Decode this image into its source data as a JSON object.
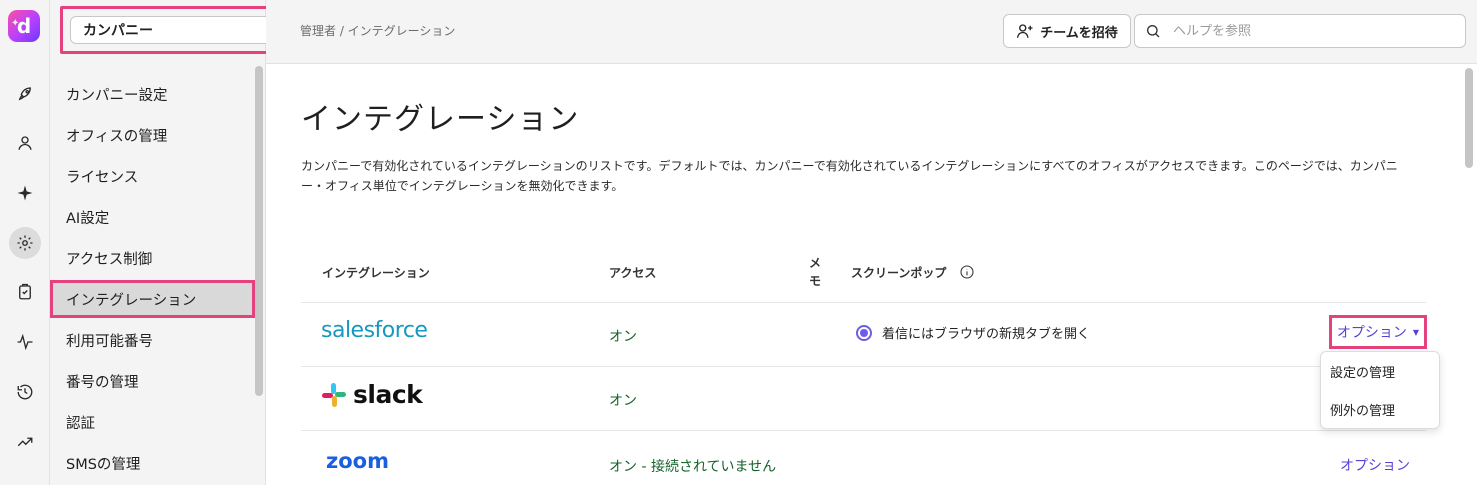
{
  "brand": {
    "logo_letter": "d",
    "accent": "#e6417f",
    "link_color": "#5a3fd8"
  },
  "rail": {
    "icons": [
      "rocket-icon",
      "user-icon",
      "sparkle-icon",
      "gear-icon",
      "clipboard-icon",
      "activity-icon",
      "history-icon",
      "trend-icon"
    ]
  },
  "sidebar": {
    "company_select": "カンパニー",
    "items": [
      "カンパニー設定",
      "オフィスの管理",
      "ライセンス",
      "AI設定",
      "アクセス制御",
      "インテグレーション",
      "利用可能番号",
      "番号の管理",
      "認証",
      "SMSの管理"
    ],
    "active_index": 5
  },
  "header": {
    "breadcrumb": "管理者 / インテグレーション",
    "invite_label": "チームを招待",
    "help_placeholder": "ヘルプを参照"
  },
  "main": {
    "title": "インテグレーション",
    "description": "カンパニーで有効化されているインテグレーションのリストです。デフォルトでは、カンパニーで有効化されているインテグレーションにすべてのオフィスがアクセスできます。このページでは、カンパニー・オフィス単位でインテグレーションを無効化できます。",
    "columns": {
      "integration": "インテグレーション",
      "access": "アクセス",
      "memo": "メモ",
      "screenpop": "スクリーンポップ"
    },
    "rows": [
      {
        "name": "salesforce",
        "access": "オン",
        "screenpop": "着信にはブラウザの新規タブを開く",
        "options": "オプション"
      },
      {
        "name": "slack",
        "access": "オン"
      },
      {
        "name": "zoom",
        "access": "オン - 接続されていません",
        "options": "オプション"
      }
    ],
    "options_menu": [
      "設定の管理",
      "例外の管理"
    ]
  }
}
